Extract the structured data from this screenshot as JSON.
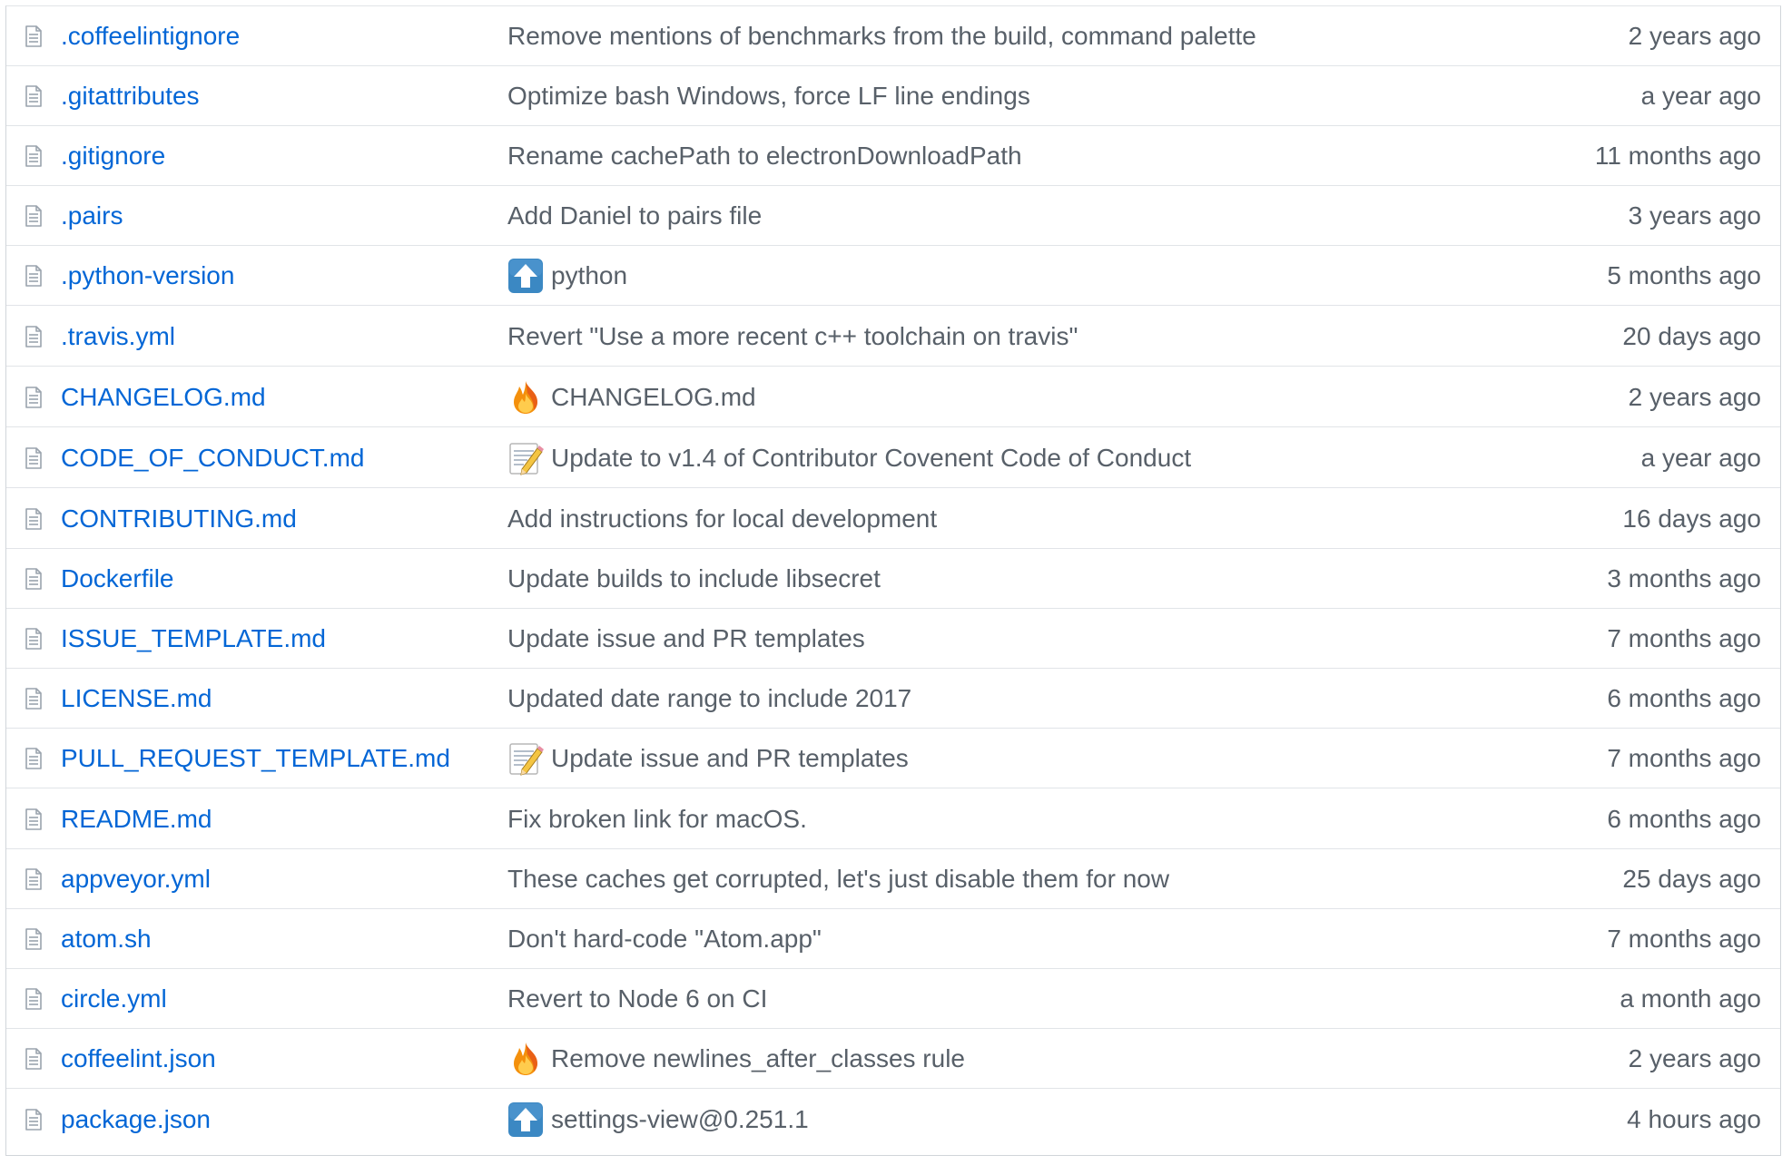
{
  "colors": {
    "link": "#0366d6",
    "muted_text": "#586069",
    "row_border": "#e1e4e8",
    "outer_border": "#d1d5da",
    "file_icon": "#9aa3ad"
  },
  "files": [
    {
      "name": ".coffeelintignore",
      "icon": "file-icon",
      "commit_emoji": "",
      "commit_message": "Remove mentions of benchmarks from the build, command palette",
      "age": "2 years ago"
    },
    {
      "name": ".gitattributes",
      "icon": "file-icon",
      "commit_emoji": "",
      "commit_message": "Optimize bash Windows, force LF line endings",
      "age": "a year ago"
    },
    {
      "name": ".gitignore",
      "icon": "file-icon",
      "commit_emoji": "",
      "commit_message": "Rename cachePath to electronDownloadPath",
      "age": "11 months ago"
    },
    {
      "name": ".pairs",
      "icon": "file-icon",
      "commit_emoji": "",
      "commit_message": "Add Daniel to pairs file",
      "age": "3 years ago"
    },
    {
      "name": ".python-version",
      "icon": "file-icon",
      "commit_emoji": "arrow-up-emoji",
      "commit_message": "python",
      "age": "5 months ago"
    },
    {
      "name": ".travis.yml",
      "icon": "file-icon",
      "commit_emoji": "",
      "commit_message": "Revert \"Use a more recent c++ toolchain on travis\"",
      "age": "20 days ago"
    },
    {
      "name": "CHANGELOG.md",
      "icon": "file-icon",
      "commit_emoji": "fire-emoji",
      "commit_message": "CHANGELOG.md",
      "age": "2 years ago"
    },
    {
      "name": "CODE_OF_CONDUCT.md",
      "icon": "file-icon",
      "commit_emoji": "memo-emoji",
      "commit_message": "Update to v1.4 of Contributor Covenent Code of Conduct",
      "age": "a year ago"
    },
    {
      "name": "CONTRIBUTING.md",
      "icon": "file-icon",
      "commit_emoji": "",
      "commit_message": "Add instructions for local development",
      "age": "16 days ago"
    },
    {
      "name": "Dockerfile",
      "icon": "file-icon",
      "commit_emoji": "",
      "commit_message": "Update builds to include libsecret",
      "age": "3 months ago"
    },
    {
      "name": "ISSUE_TEMPLATE.md",
      "icon": "file-icon",
      "commit_emoji": "",
      "commit_message": "Update issue and PR templates",
      "age": "7 months ago"
    },
    {
      "name": "LICENSE.md",
      "icon": "file-icon",
      "commit_emoji": "",
      "commit_message": "Updated date range to include 2017",
      "age": "6 months ago"
    },
    {
      "name": "PULL_REQUEST_TEMPLATE.md",
      "icon": "file-icon",
      "commit_emoji": "memo-emoji",
      "commit_message": "Update issue and PR templates",
      "age": "7 months ago"
    },
    {
      "name": "README.md",
      "icon": "file-icon",
      "commit_emoji": "",
      "commit_message": "Fix broken link for macOS.",
      "age": "6 months ago"
    },
    {
      "name": "appveyor.yml",
      "icon": "file-icon",
      "commit_emoji": "",
      "commit_message": "These caches get corrupted, let's just disable them for now",
      "age": "25 days ago"
    },
    {
      "name": "atom.sh",
      "icon": "file-icon",
      "commit_emoji": "",
      "commit_message": "Don't hard-code \"Atom.app\"",
      "age": "7 months ago"
    },
    {
      "name": "circle.yml",
      "icon": "file-icon",
      "commit_emoji": "",
      "commit_message": "Revert to Node 6 on CI",
      "age": "a month ago"
    },
    {
      "name": "coffeelint.json",
      "icon": "file-icon",
      "commit_emoji": "fire-emoji",
      "commit_message": "Remove newlines_after_classes rule",
      "age": "2 years ago"
    },
    {
      "name": "package.json",
      "icon": "file-icon",
      "commit_emoji": "arrow-up-emoji",
      "commit_message": "settings-view@0.251.1",
      "age": "4 hours ago"
    }
  ]
}
